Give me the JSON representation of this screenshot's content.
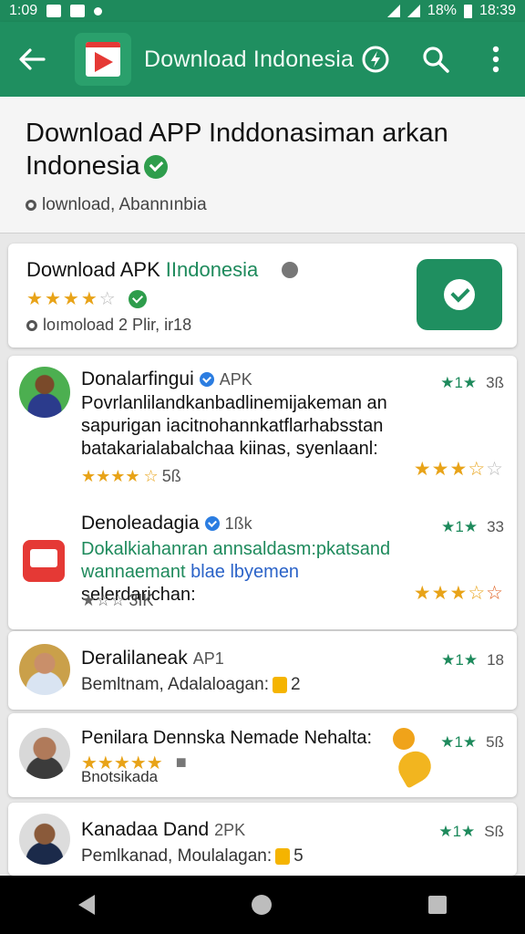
{
  "status_bar": {
    "time_left": "1:09",
    "battery": "18%",
    "time_right": "18:39"
  },
  "app_bar": {
    "title": "Download Indonesia"
  },
  "header": {
    "title": "Download APP Inddonasiman arkan Indonesia",
    "subtitle": "lownload, Abannınbia"
  },
  "featured": {
    "title": "Download APK",
    "title_highlight": "IIndonesia",
    "meta": "loımoload 2 Plir, ir18"
  },
  "reviews": [
    {
      "name": "Donalarfingui",
      "tag": "APK",
      "body": "Povrlanlilandkanbadlinemijakeman an sapurigan iacitnohannkatflarhabsstan batakarialabalchaa kiinas, syenlaanl:",
      "count": "5ß",
      "score": "3ß"
    },
    {
      "name": "Denoleadagia",
      "tag": "1ßk",
      "body_green": "Dokalkiahanran annsaldasm:pkatsand",
      "body_line2_a": "wannaemant",
      "body_line2_b": "blae lbyemen",
      "body_line2_c": "selerdarichan:",
      "count": "3IK",
      "score": "33"
    },
    {
      "name": "Deralilaneak",
      "tag": "AP1",
      "sub": "Bemltnam, Adalaloagan:",
      "sub_count": "2",
      "score": "18"
    },
    {
      "name": "Penilara Dennska Nemade Nehalta:",
      "sub": "Bnotsikada",
      "score": "5ß"
    },
    {
      "name": "Kanadaa Dand",
      "tag": "2PK",
      "sub": "Pemlkanad, Moulalagan:",
      "sub_count": "5",
      "score": "Sß"
    }
  ]
}
